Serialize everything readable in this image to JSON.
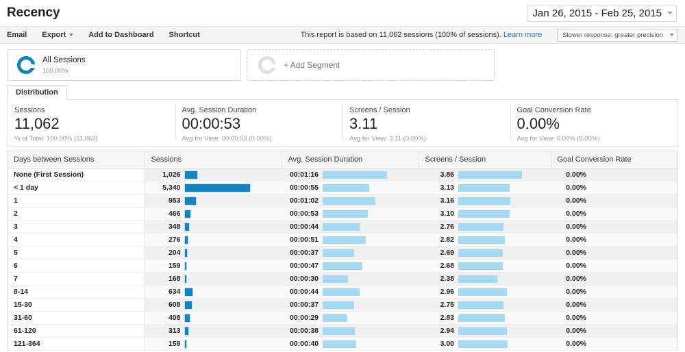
{
  "header": {
    "title": "Recency",
    "date_range": "Jan 26, 2015 - Feb 25, 2015"
  },
  "toolbar": {
    "email_label": "Email",
    "export_label": "Export",
    "add_to_dashboard_label": "Add to Dashboard",
    "shortcut_label": "Shortcut",
    "sampling_note": "This report is based on 11,062 sessions (100% of sessions).",
    "learn_more_label": "Learn more",
    "precision_selected": "Slower response, greater precision"
  },
  "segments": {
    "all_sessions_label": "All Sessions",
    "all_sessions_pct": "100.00%",
    "add_segment_label": "+ Add Segment"
  },
  "tabs": [
    {
      "label": "Distribution",
      "active": true
    }
  ],
  "summary": [
    {
      "title": "Sessions",
      "value": "11,062",
      "sub": "% of Total: 100.00% (11,062)"
    },
    {
      "title": "Avg. Session Duration",
      "value": "00:00:53",
      "sub": "Avg for View: 00:00:53 (0.00%)"
    },
    {
      "title": "Screens / Session",
      "value": "3.11",
      "sub": "Avg for View: 3.11 (0.00%)"
    },
    {
      "title": "Goal Conversion Rate",
      "value": "0.00%",
      "sub": "Avg for View: 0.00% (0.00%)"
    }
  ],
  "table": {
    "columns": [
      "Days between Sessions",
      "Sessions",
      "Avg. Session Duration",
      "Screens / Session",
      "Goal Conversion Rate"
    ],
    "rows": [
      {
        "dim": "None (First Session)",
        "sessions": "1,026",
        "sessions_n": 1026,
        "duration": "00:01:16",
        "duration_n": 76,
        "screens": "3.86",
        "screens_n": 3.86,
        "goal": "0.00%",
        "goal_n": 0
      },
      {
        "dim": "< 1 day",
        "sessions": "5,340",
        "sessions_n": 5340,
        "duration": "00:00:55",
        "duration_n": 55,
        "screens": "3.13",
        "screens_n": 3.13,
        "goal": "0.00%",
        "goal_n": 0
      },
      {
        "dim": "1",
        "sessions": "953",
        "sessions_n": 953,
        "duration": "00:01:02",
        "duration_n": 62,
        "screens": "3.16",
        "screens_n": 3.16,
        "goal": "0.00%",
        "goal_n": 0
      },
      {
        "dim": "2",
        "sessions": "466",
        "sessions_n": 466,
        "duration": "00:00:53",
        "duration_n": 53,
        "screens": "3.10",
        "screens_n": 3.1,
        "goal": "0.00%",
        "goal_n": 0
      },
      {
        "dim": "3",
        "sessions": "348",
        "sessions_n": 348,
        "duration": "00:00:44",
        "duration_n": 44,
        "screens": "2.76",
        "screens_n": 2.76,
        "goal": "0.00%",
        "goal_n": 0
      },
      {
        "dim": "4",
        "sessions": "276",
        "sessions_n": 276,
        "duration": "00:00:51",
        "duration_n": 51,
        "screens": "2.82",
        "screens_n": 2.82,
        "goal": "0.00%",
        "goal_n": 0
      },
      {
        "dim": "5",
        "sessions": "204",
        "sessions_n": 204,
        "duration": "00:00:37",
        "duration_n": 37,
        "screens": "2.69",
        "screens_n": 2.69,
        "goal": "0.00%",
        "goal_n": 0
      },
      {
        "dim": "6",
        "sessions": "159",
        "sessions_n": 159,
        "duration": "00:00:47",
        "duration_n": 47,
        "screens": "2.68",
        "screens_n": 2.68,
        "goal": "0.00%",
        "goal_n": 0
      },
      {
        "dim": "7",
        "sessions": "168",
        "sessions_n": 168,
        "duration": "00:00:30",
        "duration_n": 30,
        "screens": "2.38",
        "screens_n": 2.38,
        "goal": "0.00%",
        "goal_n": 0
      },
      {
        "dim": "8-14",
        "sessions": "634",
        "sessions_n": 634,
        "duration": "00:00:44",
        "duration_n": 44,
        "screens": "2.96",
        "screens_n": 2.96,
        "goal": "0.00%",
        "goal_n": 0
      },
      {
        "dim": "15-30",
        "sessions": "608",
        "sessions_n": 608,
        "duration": "00:00:37",
        "duration_n": 37,
        "screens": "2.75",
        "screens_n": 2.75,
        "goal": "0.00%",
        "goal_n": 0
      },
      {
        "dim": "31-60",
        "sessions": "408",
        "sessions_n": 408,
        "duration": "00:00:29",
        "duration_n": 29,
        "screens": "2.83",
        "screens_n": 2.83,
        "goal": "0.00%",
        "goal_n": 0
      },
      {
        "dim": "61-120",
        "sessions": "313",
        "sessions_n": 313,
        "duration": "00:00:38",
        "duration_n": 38,
        "screens": "2.94",
        "screens_n": 2.94,
        "goal": "0.00%",
        "goal_n": 0
      },
      {
        "dim": "121-364",
        "sessions": "159",
        "sessions_n": 159,
        "duration": "00:00:40",
        "duration_n": 40,
        "screens": "3.00",
        "screens_n": 3.0,
        "goal": "0.00%",
        "goal_n": 0
      }
    ]
  },
  "colors": {
    "bar_dark": "#1283c3",
    "bar_light": "#a5daf5",
    "link": "#2a72c4"
  },
  "chart_data": {
    "type": "bar",
    "title": "Recency - Days between Sessions",
    "categories": [
      "None (First Session)",
      "< 1 day",
      "1",
      "2",
      "3",
      "4",
      "5",
      "6",
      "7",
      "8-14",
      "15-30",
      "31-60",
      "61-120",
      "121-364"
    ],
    "series": [
      {
        "name": "Sessions",
        "values": [
          1026,
          5340,
          953,
          466,
          348,
          276,
          204,
          159,
          168,
          634,
          608,
          408,
          313,
          159
        ]
      },
      {
        "name": "Avg. Session Duration (seconds)",
        "values": [
          76,
          55,
          62,
          53,
          44,
          51,
          37,
          47,
          30,
          44,
          37,
          29,
          38,
          40
        ]
      },
      {
        "name": "Screens / Session",
        "values": [
          3.86,
          3.13,
          3.16,
          3.1,
          2.76,
          2.82,
          2.69,
          2.68,
          2.38,
          2.96,
          2.75,
          2.83,
          2.94,
          3.0
        ]
      },
      {
        "name": "Goal Conversion Rate (%)",
        "values": [
          0,
          0,
          0,
          0,
          0,
          0,
          0,
          0,
          0,
          0,
          0,
          0,
          0,
          0
        ]
      }
    ],
    "xlabel": "Days between Sessions",
    "ylabel": "Sessions",
    "grid": false,
    "legend": "none"
  }
}
